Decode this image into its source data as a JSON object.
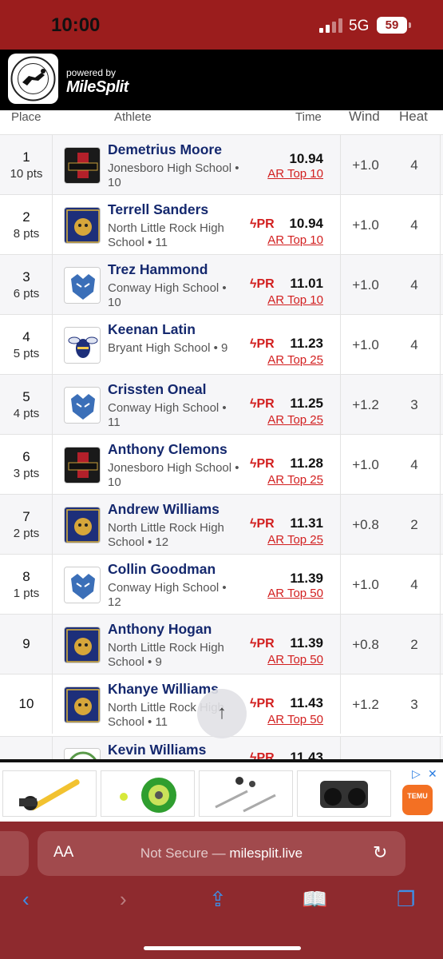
{
  "status_bar": {
    "time": "10:00",
    "network": "5G",
    "battery": "59"
  },
  "header": {
    "powered_by": "powered by",
    "brand": "MileSplit"
  },
  "columns": {
    "place": "Place",
    "athlete": "Athlete",
    "time": "Time",
    "wind": "Wind",
    "heat": "Heat"
  },
  "results": [
    {
      "place": "1",
      "points": "10 pts",
      "athlete": "Demetrius Moore",
      "school": "Jonesboro High School • 10",
      "pr": "",
      "time": "10.94",
      "rank": "AR Top 10",
      "wind": "+1.0",
      "heat": "4"
    },
    {
      "place": "2",
      "points": "8 pts",
      "athlete": "Terrell Sanders",
      "school": "North Little Rock High School • 11",
      "pr": "PR",
      "time": "10.94",
      "rank": "AR Top 10",
      "wind": "+1.0",
      "heat": "4"
    },
    {
      "place": "3",
      "points": "6 pts",
      "athlete": "Trez Hammond",
      "school": "Conway High School • 10",
      "pr": "PR",
      "time": "11.01",
      "rank": "AR Top 10",
      "wind": "+1.0",
      "heat": "4"
    },
    {
      "place": "4",
      "points": "5 pts",
      "athlete": "Keenan Latin",
      "school": "Bryant High School • 9",
      "pr": "PR",
      "time": "11.23",
      "rank": "AR Top 25",
      "wind": "+1.0",
      "heat": "4"
    },
    {
      "place": "5",
      "points": "4 pts",
      "athlete": "Crissten Oneal",
      "school": "Conway High School • 11",
      "pr": "PR",
      "time": "11.25",
      "rank": "AR Top 25",
      "wind": "+1.2",
      "heat": "3"
    },
    {
      "place": "6",
      "points": "3 pts",
      "athlete": "Anthony Clemons",
      "school": "Jonesboro High School • 10",
      "pr": "PR",
      "time": "11.28",
      "rank": "AR Top 25",
      "wind": "+1.0",
      "heat": "4"
    },
    {
      "place": "7",
      "points": "2 pts",
      "athlete": "Andrew Williams",
      "school": "North Little Rock High School • 12",
      "pr": "PR",
      "time": "11.31",
      "rank": "AR Top 25",
      "wind": "+0.8",
      "heat": "2"
    },
    {
      "place": "8",
      "points": "1 pts",
      "athlete": "Collin Goodman",
      "school": "Conway High School • 12",
      "pr": "",
      "time": "11.39",
      "rank": "AR Top 50",
      "wind": "+1.0",
      "heat": "4"
    },
    {
      "place": "9",
      "points": "",
      "athlete": "Anthony Hogan",
      "school": "North Little Rock High School • 9",
      "pr": "PR",
      "time": "11.39",
      "rank": "AR Top 50",
      "wind": "+0.8",
      "heat": "2"
    },
    {
      "place": "10",
      "points": "",
      "athlete": "Khanye Williams",
      "school": "North Little Rock High School • 11",
      "pr": "PR",
      "time": "11.43",
      "rank": "AR Top 50",
      "wind": "+1.2",
      "heat": "3"
    }
  ],
  "partial_row": {
    "athlete": "Kevin Williams",
    "pr": "PR",
    "time": "11.43"
  },
  "ad": {
    "brand": "TEMU"
  },
  "browser": {
    "aa": "AA",
    "security": "Not Secure —",
    "domain": "milesplit.live"
  }
}
